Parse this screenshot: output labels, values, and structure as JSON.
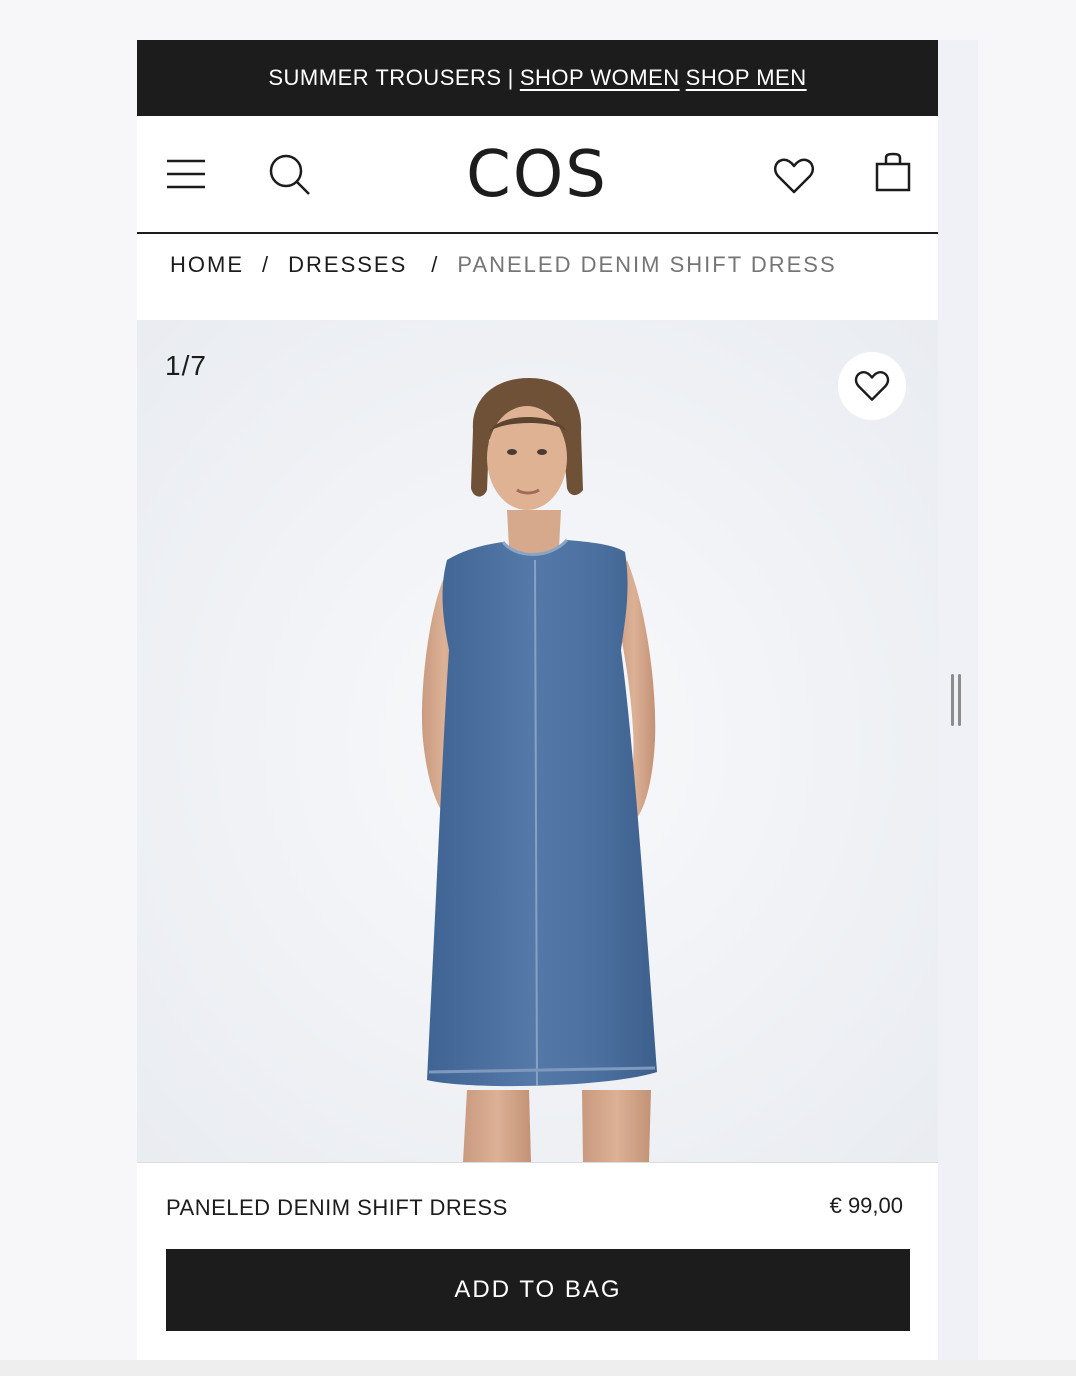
{
  "promo": {
    "text": "SUMMER TROUSERS",
    "separator": "|",
    "link_women": "SHOP WOMEN",
    "link_men": "SHOP MEN"
  },
  "header": {
    "logo": "COS",
    "icons": [
      "menu-icon",
      "search-icon",
      "heart-icon",
      "shopping-bag-icon"
    ]
  },
  "breadcrumb": {
    "items": [
      "HOME",
      "DRESSES",
      "PANELED DENIM SHIFT DRESS"
    ],
    "separator": "/"
  },
  "gallery": {
    "counter": "1/7",
    "favorite_icon": "heart-icon"
  },
  "product": {
    "name": "PANELED DENIM SHIFT DRESS",
    "price": "€ 99,00",
    "add_to_bag_label": "ADD TO BAG"
  },
  "colors": {
    "primary": "#1c1c1c",
    "background": "#ffffff",
    "gallery_bg": "#eff1f5",
    "denim": "#4a6e9e",
    "muted_text": "#757575"
  }
}
